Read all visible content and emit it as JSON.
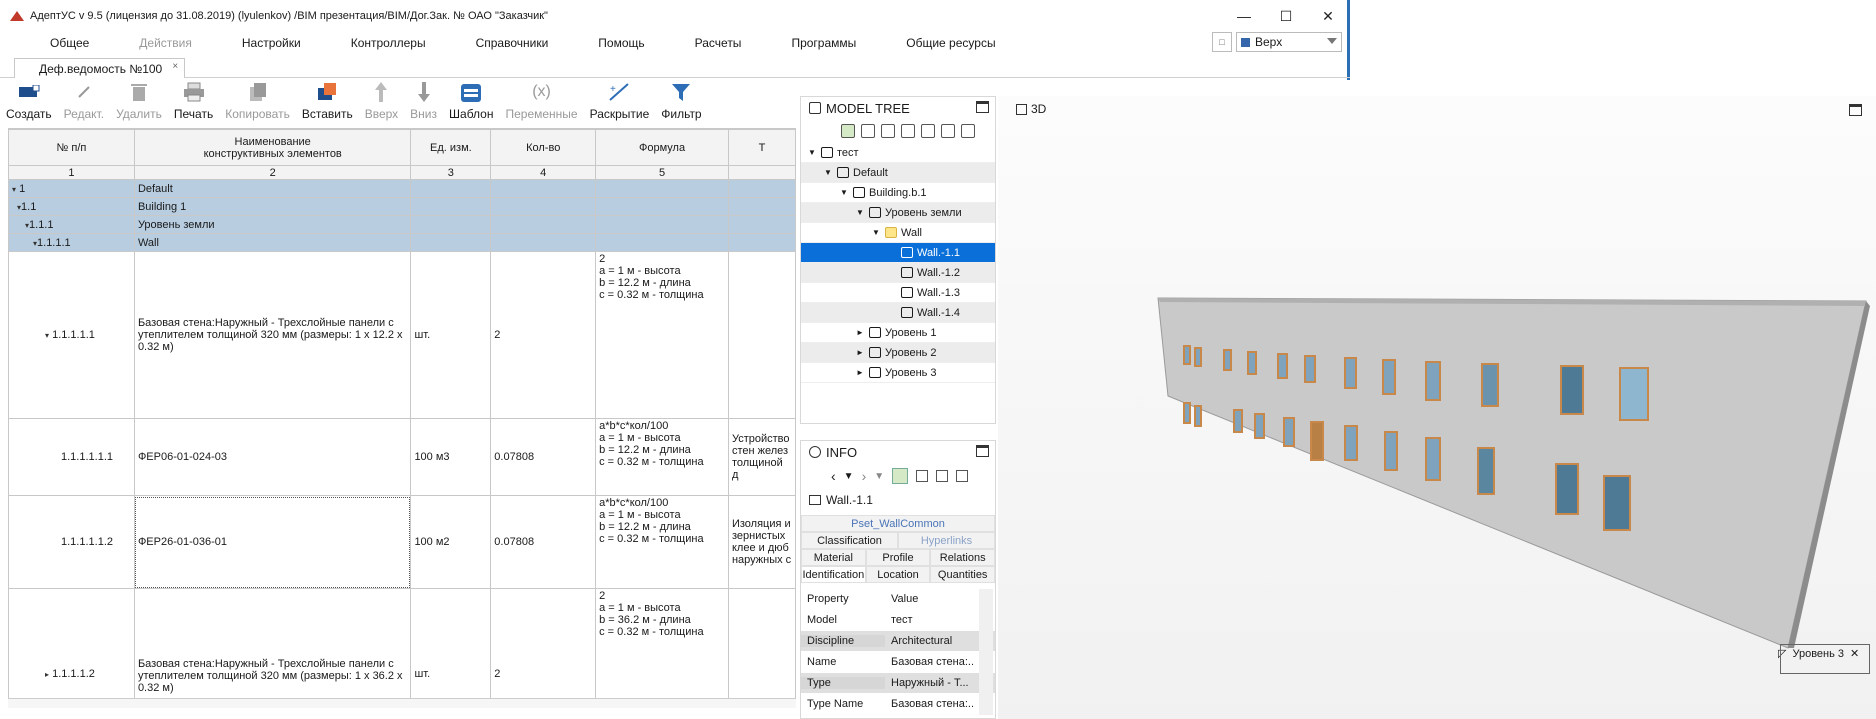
{
  "window": {
    "title": "АдептУС  v 9.5 (лицензия до 31.08.2019) (lyulenkov) /BIM презентация/BIM/Дог.Зак. № ОАО \"Заказчик\"",
    "minimize": "—",
    "maximize": "☐",
    "close": "✕"
  },
  "menu": [
    "Общее",
    "Действия",
    "Настройки",
    "Контроллеры",
    "Справочники",
    "Помощь",
    "Расчеты",
    "Программы",
    "Общие ресурсы"
  ],
  "view_select": {
    "value": "Верх"
  },
  "doc_tab": {
    "label": "Деф.ведомость №100",
    "close": "×"
  },
  "toolbar": [
    {
      "label": "Создать",
      "enabled": true
    },
    {
      "label": "Редакт.",
      "enabled": false
    },
    {
      "label": "Удалить",
      "enabled": false
    },
    {
      "label": "Печать",
      "enabled": true
    },
    {
      "label": "Копировать",
      "enabled": false
    },
    {
      "label": "Вставить",
      "enabled": true
    },
    {
      "label": "Вверх",
      "enabled": false
    },
    {
      "label": "Вниз",
      "enabled": false
    },
    {
      "label": "Шаблон",
      "enabled": true
    },
    {
      "label": "Переменные",
      "enabled": false
    },
    {
      "label": "Раскрытие",
      "enabled": true
    },
    {
      "label": "Фильтр",
      "enabled": true
    }
  ],
  "table": {
    "headers": [
      "№ п/п",
      "Наименование\nконструктивных элементов",
      "Ед. изм.",
      "Кол-во",
      "Формула",
      "Т"
    ],
    "col_numbers": [
      "1",
      "2",
      "3",
      "4",
      "5",
      ""
    ],
    "groups": [
      {
        "num": "1",
        "name": "Default"
      },
      {
        "num": "1.1",
        "name": "Building 1"
      },
      {
        "num": "1.1.1",
        "name": "Уровень земли"
      },
      {
        "num": "1.1.1.1",
        "name": "Wall"
      }
    ],
    "rows": [
      {
        "num": "1.1.1.1.1",
        "name": "Базовая стена:Наружный - Трехслойные панели с утеплителем толщиной 320 мм (размеры: 1 x 12.2 x 0.32 м)",
        "unit": "шт.",
        "qty": "2",
        "formula": "2\na = 1 м - высота\nb = 12.2 м - длина\nc = 0.32 м - толщина",
        "extra": ""
      },
      {
        "num": "1.1.1.1.1.1",
        "name": "ФЕР06-01-024-03",
        "unit": "100 м3",
        "qty": "0.07808",
        "formula": "a*b*c*кол/100\na = 1 м - высота\nb = 12.2 м - длина\nc = 0.32 м - толщина",
        "extra": "Устройство\nстен желез\nтолщиной д"
      },
      {
        "num": "1.1.1.1.1.2",
        "name": "ФЕР26-01-036-01",
        "unit": "100 м2",
        "qty": "0.07808",
        "formula": "a*b*c*кол/100\na = 1 м - высота\nb = 12.2 м - длина\nc = 0.32 м - толщина",
        "extra": "Изоляция и\nзернистых\nклее и дюб\nнаружных с"
      },
      {
        "num": "1.1.1.1.2",
        "name": "Базовая стена:Наружный - Трехслойные панели с утеплителем толщиной 320 мм (размеры: 1 x 36.2 x 0.32 м)",
        "unit": "шт.",
        "qty": "2",
        "formula": "2\na = 1 м - высота\nb = 36.2 м - длина\nc = 0.32 м - толщина",
        "extra": ""
      }
    ]
  },
  "model_tree": {
    "title": "MODEL TREE",
    "items": [
      {
        "label": "тест",
        "depth": 0,
        "twisty": "▼"
      },
      {
        "label": "Default",
        "depth": 1,
        "twisty": "▼"
      },
      {
        "label": "Building.b.1",
        "depth": 2,
        "twisty": "▼"
      },
      {
        "label": "Уровень земли",
        "depth": 3,
        "twisty": "▼"
      },
      {
        "label": "Wall",
        "depth": 4,
        "twisty": "▼"
      },
      {
        "label": "Wall.-1.1",
        "depth": 5,
        "twisty": "",
        "selected": true
      },
      {
        "label": "Wall.-1.2",
        "depth": 5,
        "twisty": ""
      },
      {
        "label": "Wall.-1.3",
        "depth": 5,
        "twisty": ""
      },
      {
        "label": "Wall.-1.4",
        "depth": 5,
        "twisty": ""
      },
      {
        "label": "Уровень 1",
        "depth": 3,
        "twisty": "►"
      },
      {
        "label": "Уровень 2",
        "depth": 3,
        "twisty": "►"
      },
      {
        "label": "Уровень 3",
        "depth": 3,
        "twisty": "►"
      }
    ]
  },
  "info": {
    "title": "INFO",
    "element": "Wall.-1.1",
    "pset": "Pset_WallCommon",
    "tabs_row1": [
      {
        "label": "Classification",
        "enabled": true
      },
      {
        "label": "Hyperlinks",
        "enabled": false
      }
    ],
    "tabs_row2": [
      "Material",
      "Profile",
      "Relations"
    ],
    "tabs_row3": [
      "Identification",
      "Location",
      "Quantities"
    ],
    "prop_header": {
      "k": "Property",
      "v": "Value"
    },
    "props": [
      {
        "k": "Model",
        "v": "тест"
      },
      {
        "k": "Discipline",
        "v": "Architectural"
      },
      {
        "k": "Name",
        "v": "Базовая стена:..."
      },
      {
        "k": "Type",
        "v": "Наружный - Т..."
      },
      {
        "k": "Type Name",
        "v": "Базовая стена:..."
      }
    ]
  },
  "viewer": {
    "label": "3D",
    "level": "Уровень 3"
  }
}
